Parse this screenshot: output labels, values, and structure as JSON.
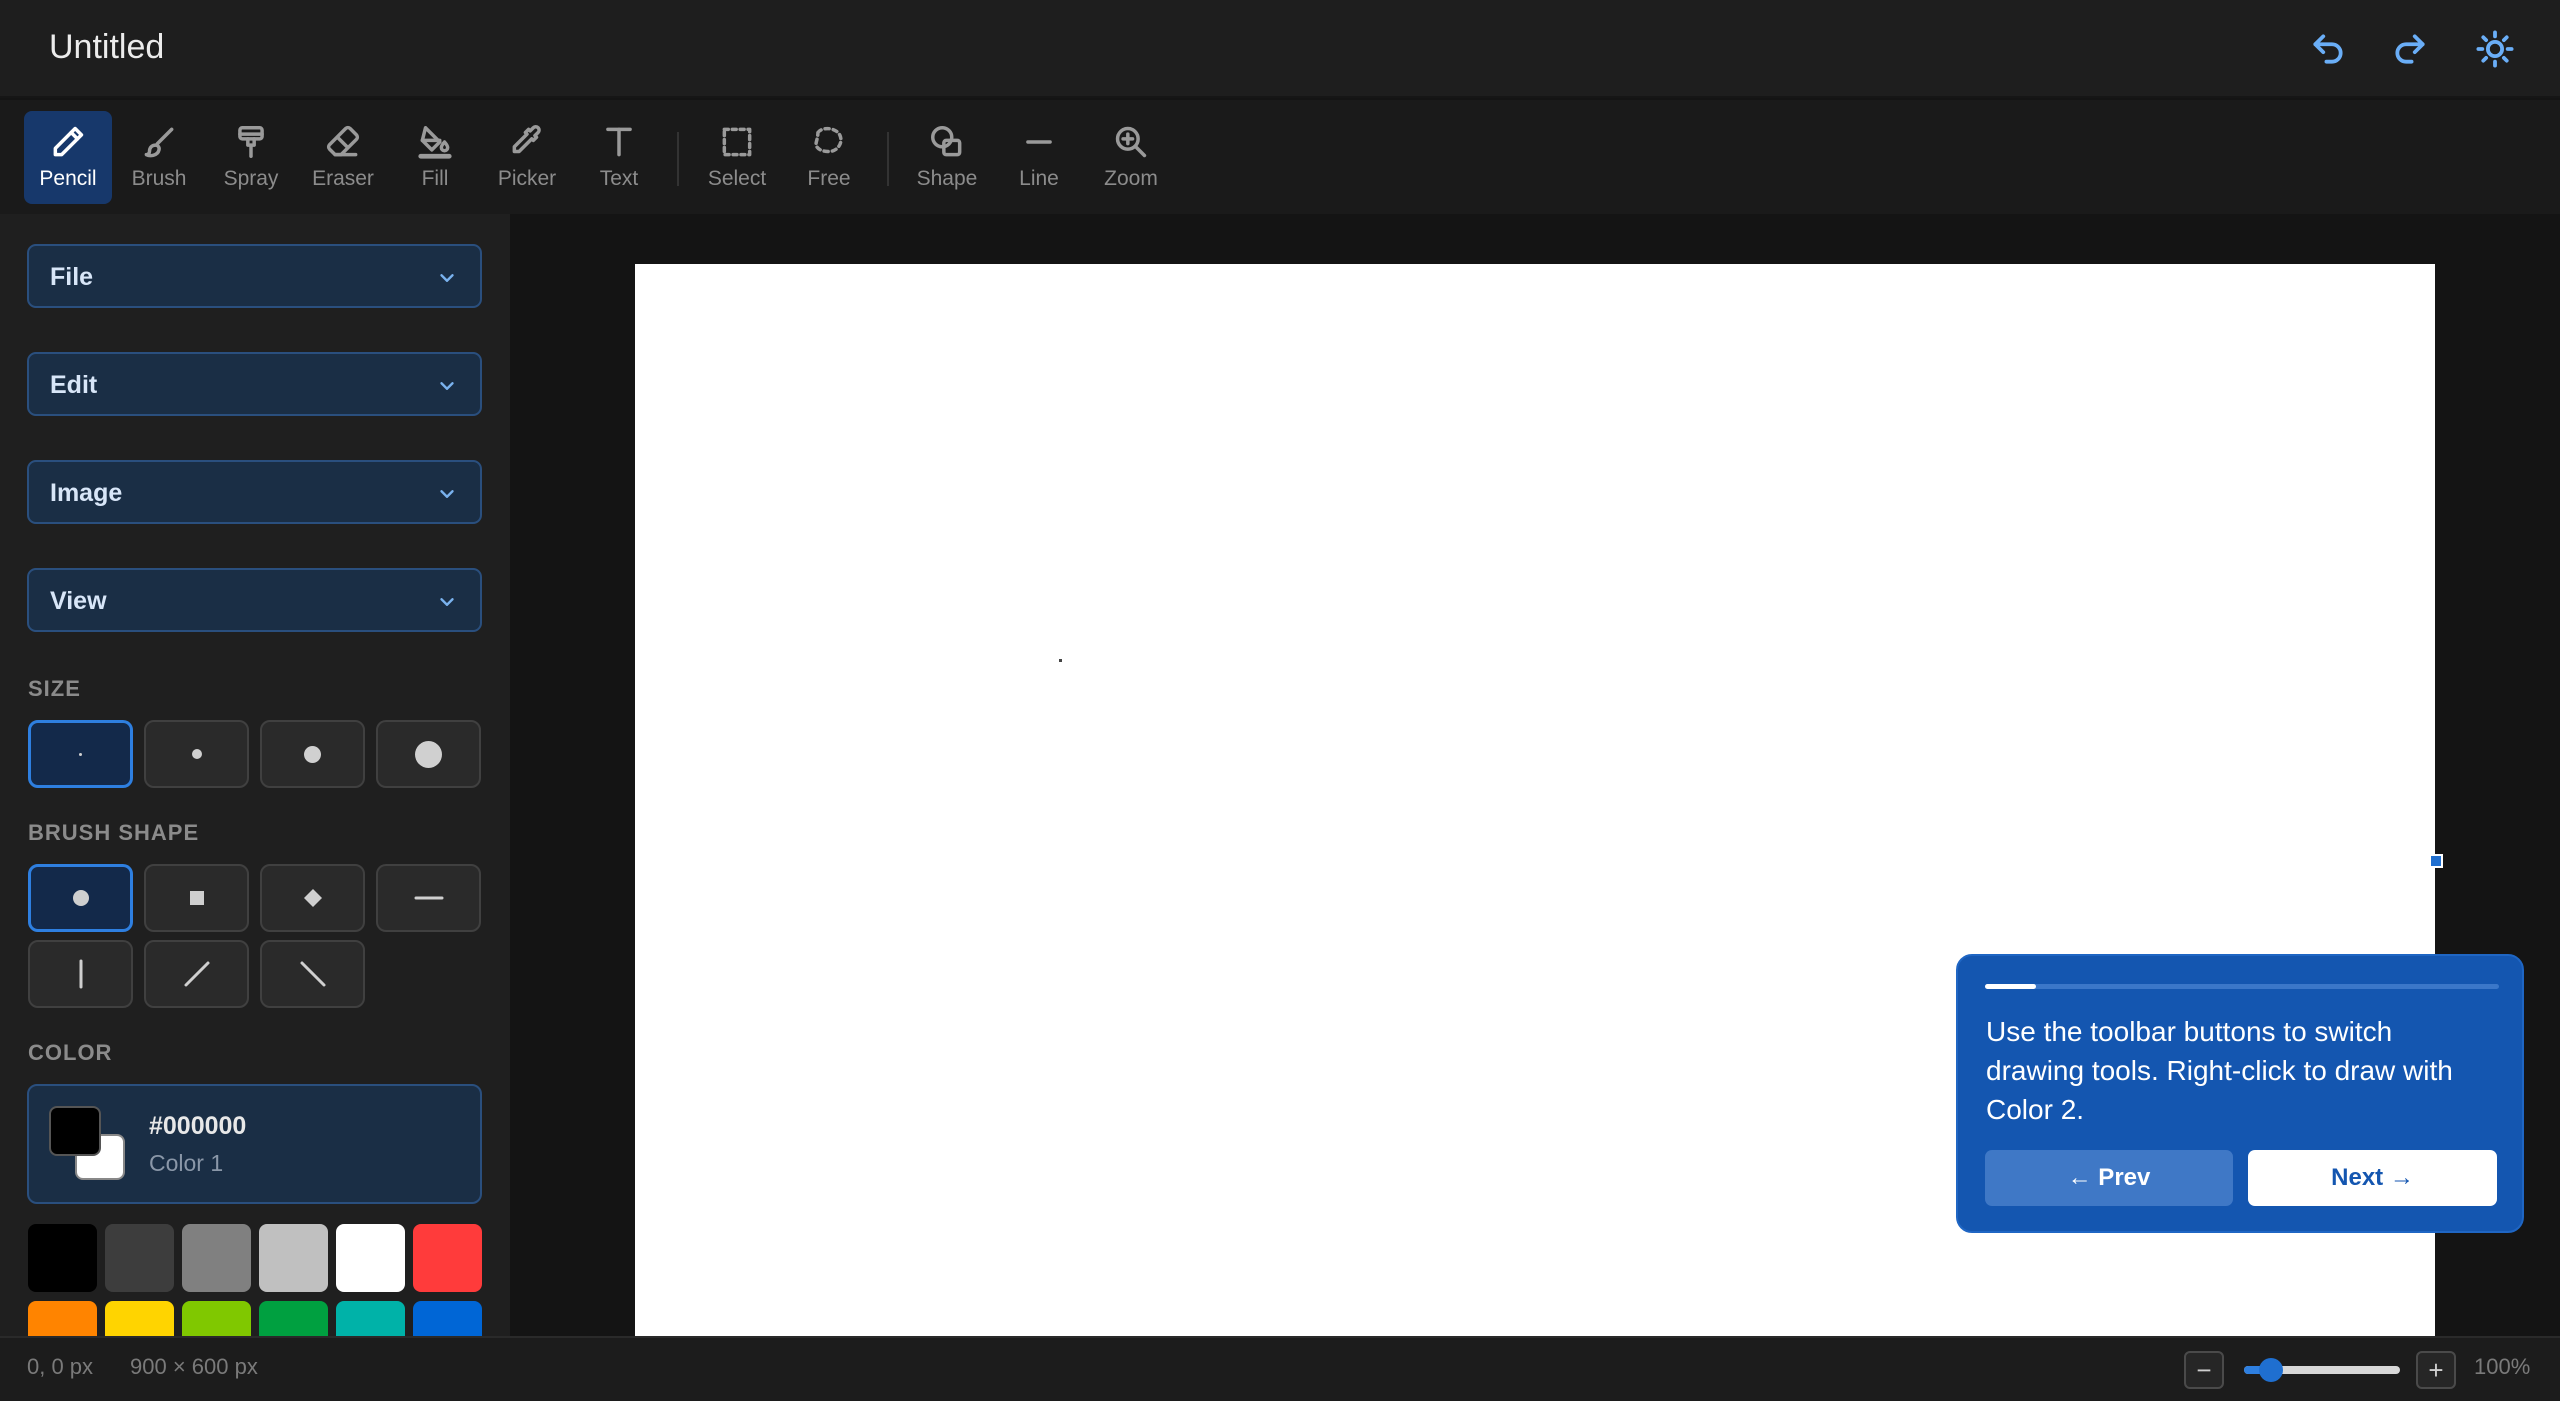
{
  "header": {
    "title": "Untitled"
  },
  "toolbar": {
    "tools": [
      {
        "label": "Pencil",
        "icon": "pencil-icon",
        "active": true
      },
      {
        "label": "Brush",
        "icon": "brush-icon"
      },
      {
        "label": "Spray",
        "icon": "spray-icon"
      },
      {
        "label": "Eraser",
        "icon": "eraser-icon"
      },
      {
        "label": "Fill",
        "icon": "fill-bucket-icon"
      },
      {
        "label": "Picker",
        "icon": "eyedropper-icon"
      },
      {
        "label": "Text",
        "icon": "text-icon"
      },
      {
        "label": "Select",
        "icon": "rect-select-icon"
      },
      {
        "label": "Free",
        "icon": "free-select-icon"
      },
      {
        "label": "Shape",
        "icon": "shape-icon"
      },
      {
        "label": "Line",
        "icon": "line-icon"
      },
      {
        "label": "Zoom",
        "icon": "zoom-icon"
      }
    ]
  },
  "menus": [
    "File",
    "Edit",
    "Image",
    "View"
  ],
  "size": {
    "label": "SIZE",
    "selected_index": 0
  },
  "brush_shape": {
    "label": "BRUSH SHAPE",
    "selected": "round"
  },
  "color": {
    "label": "COLOR",
    "hex": "#000000",
    "name": "Color 1",
    "color1": "#000000",
    "color2": "#ffffff"
  },
  "palette": [
    "#000000",
    "#3d3d3d",
    "#808080",
    "#c0c0c0",
    "#ffffff",
    "#ff3b3b",
    "#ff8400",
    "#ffd400",
    "#80c800",
    "#00a040",
    "#00b2a8",
    "#0066d6"
  ],
  "tour": {
    "message": "Use the toolbar buttons to switch drawing tools. Right-click to draw with Color 2.",
    "prev_label": "← Prev",
    "next_label": "Next →",
    "progress": 0.1
  },
  "status": {
    "coords": "0, 0 px",
    "canvas_size": "900 × 600 px",
    "zoom_out": "−",
    "zoom_in": "+",
    "zoom": "100%",
    "zoom_level": 0.1
  }
}
